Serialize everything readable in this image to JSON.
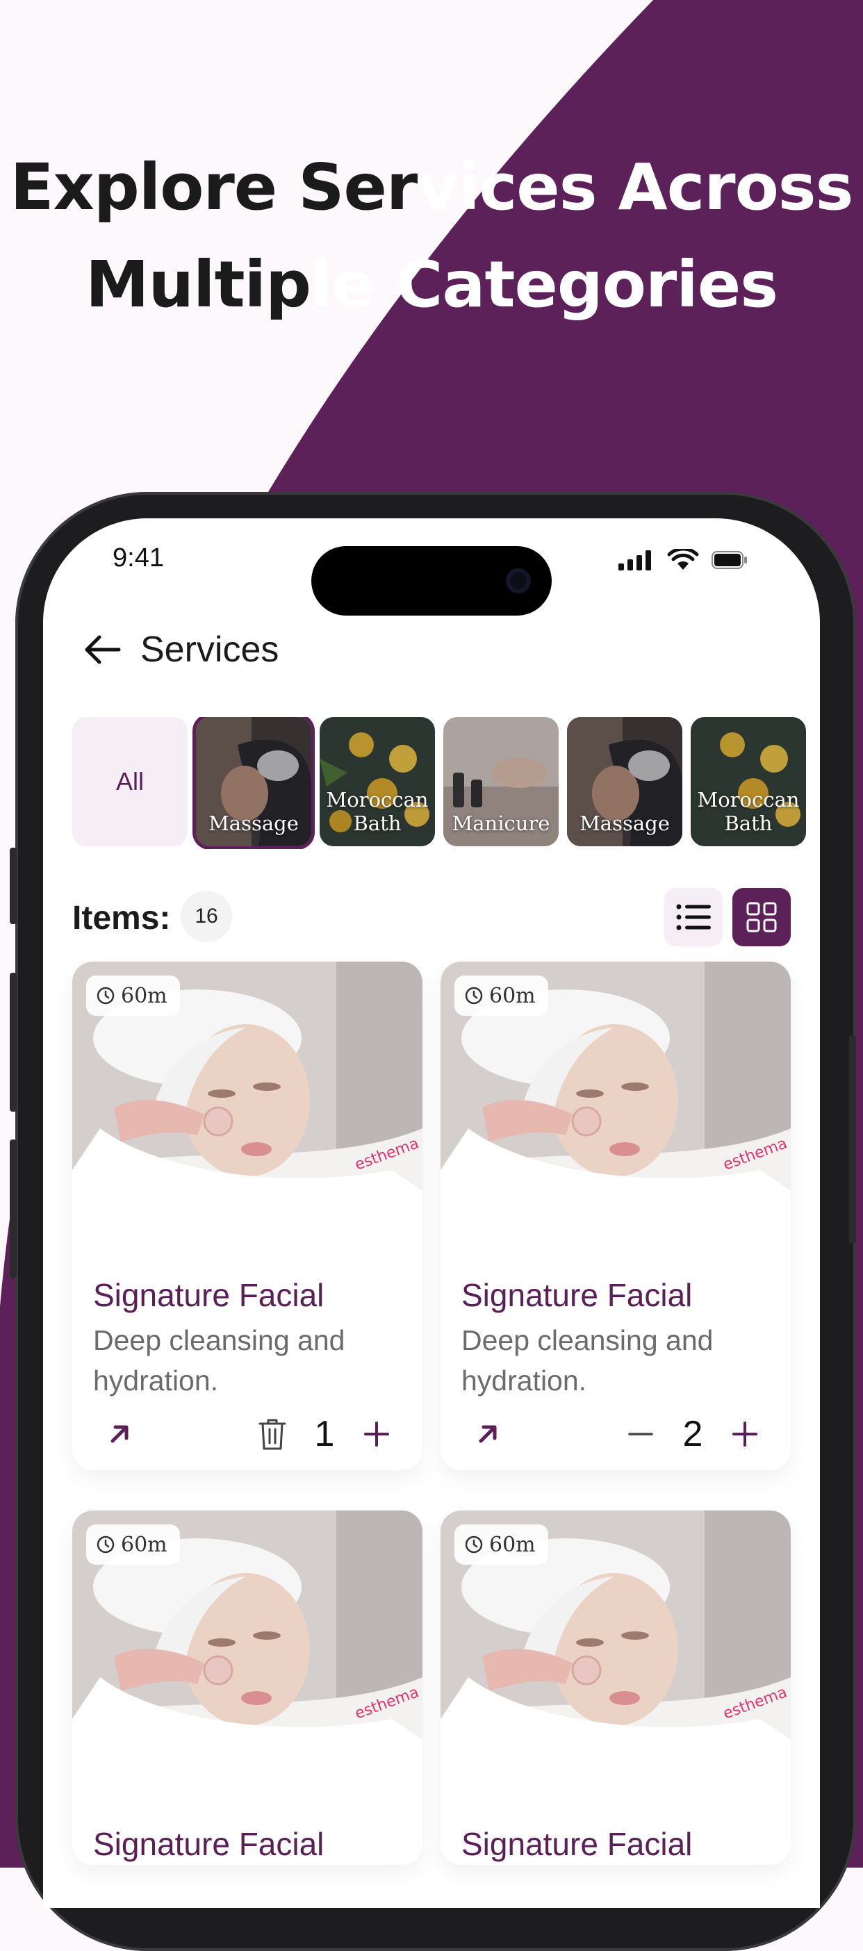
{
  "headline": {
    "line1_dark": "Explore Ser",
    "line1_light": "vices Across",
    "line2_dark": "Multip",
    "line2_light": "le Categories"
  },
  "colors": {
    "brand": "#5b2158",
    "background": "#fcf8fb"
  },
  "status_bar": {
    "time": "9:41",
    "icons": [
      "cellular-icon",
      "wifi-icon",
      "battery-icon"
    ]
  },
  "header": {
    "title": "Services",
    "back_icon": "arrow-left-icon"
  },
  "categories": [
    {
      "label": "All",
      "selected": false
    },
    {
      "label": "Massage",
      "selected": true
    },
    {
      "label": "Moroccan Bath",
      "selected": false
    },
    {
      "label": "Manicure",
      "selected": false
    },
    {
      "label": "Massage",
      "selected": false
    },
    {
      "label": "Moroccan Bath",
      "selected": false
    }
  ],
  "items": {
    "label": "Items:",
    "count": "16",
    "view_modes": [
      "list-view-icon",
      "grid-view-icon"
    ],
    "active_view": "grid"
  },
  "services": [
    {
      "duration": "60m",
      "title": "Signature Facial",
      "description": "Deep cleansing and hydration.",
      "quantity": "1",
      "decrement_icon": "trash-icon"
    },
    {
      "duration": "60m",
      "title": "Signature Facial",
      "description": "Deep cleansing and hydration.",
      "quantity": "2",
      "decrement_icon": "minus-icon"
    },
    {
      "duration": "60m",
      "title": "Signature Facial"
    },
    {
      "duration": "60m",
      "title": "Signature Facial"
    }
  ]
}
